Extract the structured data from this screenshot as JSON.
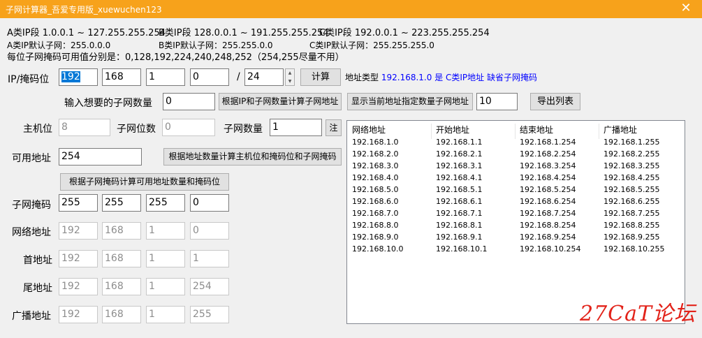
{
  "window": {
    "title": "子网计算器_吾爱专用版_xuewuchen123",
    "close_glyph": "✕"
  },
  "info": {
    "class_a_range": "A类IP段 1.0.0.1 ~ 127.255.255.254",
    "class_b_range": "B类IP段 128.0.0.1 ~ 191.255.255.254",
    "class_c_range": "C类IP段 192.0.0.1 ~ 223.255.255.254",
    "class_a_default": "A类IP默认子网：255.0.0.0",
    "class_b_default": "B类IP默认子网：255.255.0.0",
    "class_c_default": "C类IP默认子网：255.255.255.0",
    "mask_values": "每位子网掩码可用值分别是：0,128,192,224,240,248,252（254,255尽量不用）"
  },
  "ip_row": {
    "label": "IP/掩码位",
    "octets": [
      "192",
      "168",
      "1",
      "0"
    ],
    "slash": "/",
    "prefix": "24",
    "spin_up": "▲",
    "spin_down": "▼",
    "calc_label": "计算",
    "addr_type_label": "地址类型",
    "addr_value": "192.168.1.0",
    "addr_desc": "是 C类IP地址",
    "mask_note": "缺省子网掩码"
  },
  "subnet_count_row": {
    "label": "输入想要的子网数量",
    "value": "0",
    "calc_by_ip_button": "根据IP和子网数量计算子网地址",
    "show_subnets_button": "显示当前地址指定数量子网地址",
    "count_value": "10",
    "export_button": "导出列表"
  },
  "host_row": {
    "host_bits_label": "主机位",
    "host_bits_value": "8",
    "subnet_bits_label": "子网位数",
    "subnet_bits_value": "0",
    "subnet_count_label": "子网数量",
    "subnet_count_value": "1",
    "note_button": "注"
  },
  "usable_row": {
    "label": "可用地址",
    "value": "254",
    "calc_button": "根据地址数量计算主机位和掩码位和子网掩码"
  },
  "mask_calc_button": "根据子网掩码计算可用地址数量和掩码位",
  "address_rows": [
    {
      "label": "子网掩码",
      "octets": [
        "255",
        "255",
        "255",
        "0"
      ],
      "enabled": true
    },
    {
      "label": "网络地址",
      "octets": [
        "192",
        "168",
        "1",
        "0"
      ],
      "enabled": false
    },
    {
      "label": "首地址",
      "octets": [
        "192",
        "168",
        "1",
        "1"
      ],
      "enabled": false
    },
    {
      "label": "尾地址",
      "octets": [
        "192",
        "168",
        "1",
        "254"
      ],
      "enabled": false
    },
    {
      "label": "广播地址",
      "octets": [
        "192",
        "168",
        "1",
        "255"
      ],
      "enabled": false
    }
  ],
  "subnet_table": {
    "columns": [
      "网络地址",
      "开始地址",
      "结束地址",
      "广播地址"
    ],
    "rows": [
      [
        "192.168.1.0",
        "192.168.1.1",
        "192.168.1.254",
        "192.168.1.255"
      ],
      [
        "192.168.2.0",
        "192.168.2.1",
        "192.168.2.254",
        "192.168.2.255"
      ],
      [
        "192.168.3.0",
        "192.168.3.1",
        "192.168.3.254",
        "192.168.3.255"
      ],
      [
        "192.168.4.0",
        "192.168.4.1",
        "192.168.4.254",
        "192.168.4.255"
      ],
      [
        "192.168.5.0",
        "192.168.5.1",
        "192.168.5.254",
        "192.168.5.255"
      ],
      [
        "192.168.6.0",
        "192.168.6.1",
        "192.168.6.254",
        "192.168.6.255"
      ],
      [
        "192.168.7.0",
        "192.168.7.1",
        "192.168.7.254",
        "192.168.7.255"
      ],
      [
        "192.168.8.0",
        "192.168.8.1",
        "192.168.8.254",
        "192.168.8.255"
      ],
      [
        "192.168.9.0",
        "192.168.9.1",
        "192.168.9.254",
        "192.168.9.255"
      ],
      [
        "192.168.10.0",
        "192.168.10.1",
        "192.168.10.254",
        "192.168.10.255"
      ]
    ]
  },
  "watermark": "27CaT论坛",
  "colors": {
    "titlebar": "#f7a21b",
    "selection": "#0078d7",
    "info_blue": "#0000ff",
    "watermark": "#e2231a"
  }
}
